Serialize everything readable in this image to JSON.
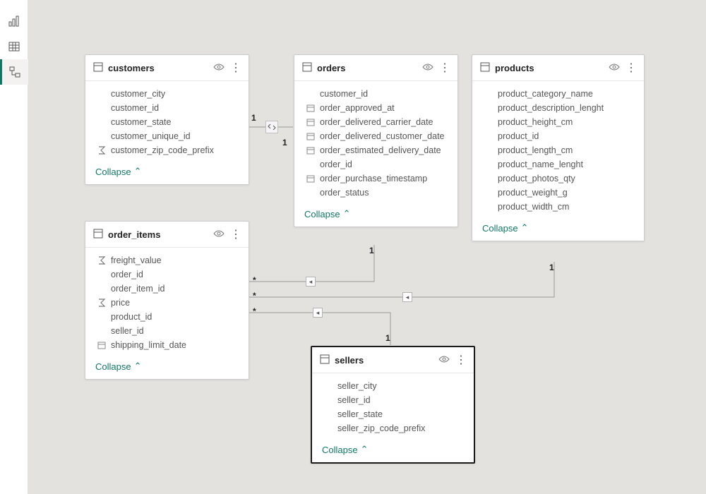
{
  "sidebar": {
    "items": [
      {
        "name": "report-view",
        "active": false
      },
      {
        "name": "data-view",
        "active": false
      },
      {
        "name": "model-view",
        "active": true
      }
    ]
  },
  "tables": {
    "customers": {
      "title": "customers",
      "collapse": "Collapse",
      "fields": [
        {
          "name": "customer_city",
          "icon": ""
        },
        {
          "name": "customer_id",
          "icon": ""
        },
        {
          "name": "customer_state",
          "icon": ""
        },
        {
          "name": "customer_unique_id",
          "icon": ""
        },
        {
          "name": "customer_zip_code_prefix",
          "icon": "sum"
        }
      ]
    },
    "orders": {
      "title": "orders",
      "collapse": "Collapse",
      "fields": [
        {
          "name": "customer_id",
          "icon": ""
        },
        {
          "name": "order_approved_at",
          "icon": "date"
        },
        {
          "name": "order_delivered_carrier_date",
          "icon": "date"
        },
        {
          "name": "order_delivered_customer_date",
          "icon": "date"
        },
        {
          "name": "order_estimated_delivery_date",
          "icon": "date"
        },
        {
          "name": "order_id",
          "icon": ""
        },
        {
          "name": "order_purchase_timestamp",
          "icon": "date"
        },
        {
          "name": "order_status",
          "icon": ""
        }
      ]
    },
    "products": {
      "title": "products",
      "collapse": "Collapse",
      "fields": [
        {
          "name": "product_category_name",
          "icon": ""
        },
        {
          "name": "product_description_lenght",
          "icon": ""
        },
        {
          "name": "product_height_cm",
          "icon": ""
        },
        {
          "name": "product_id",
          "icon": ""
        },
        {
          "name": "product_length_cm",
          "icon": ""
        },
        {
          "name": "product_name_lenght",
          "icon": ""
        },
        {
          "name": "product_photos_qty",
          "icon": ""
        },
        {
          "name": "product_weight_g",
          "icon": ""
        },
        {
          "name": "product_width_cm",
          "icon": ""
        }
      ]
    },
    "order_items": {
      "title": "order_items",
      "collapse": "Collapse",
      "fields": [
        {
          "name": "freight_value",
          "icon": "sum"
        },
        {
          "name": "order_id",
          "icon": ""
        },
        {
          "name": "order_item_id",
          "icon": ""
        },
        {
          "name": "price",
          "icon": "sum"
        },
        {
          "name": "product_id",
          "icon": ""
        },
        {
          "name": "seller_id",
          "icon": ""
        },
        {
          "name": "shipping_limit_date",
          "icon": "date"
        }
      ]
    },
    "sellers": {
      "title": "sellers",
      "collapse": "Collapse",
      "fields": [
        {
          "name": "seller_city",
          "icon": ""
        },
        {
          "name": "seller_id",
          "icon": ""
        },
        {
          "name": "seller_state",
          "icon": ""
        },
        {
          "name": "seller_zip_code_prefix",
          "icon": ""
        }
      ]
    }
  },
  "relationships": [
    {
      "from": "customers",
      "to": "orders",
      "from_card": "1",
      "to_card": "1",
      "direction": "both"
    },
    {
      "from": "orders",
      "to": "order_items",
      "from_card": "1",
      "to_card": "*",
      "direction": "single"
    },
    {
      "from": "products",
      "to": "order_items",
      "from_card": "1",
      "to_card": "*",
      "direction": "single"
    },
    {
      "from": "sellers",
      "to": "order_items",
      "from_card": "1",
      "to_card": "*",
      "direction": "single"
    }
  ],
  "cardinality_labels": {
    "one": "1",
    "many": "*"
  }
}
